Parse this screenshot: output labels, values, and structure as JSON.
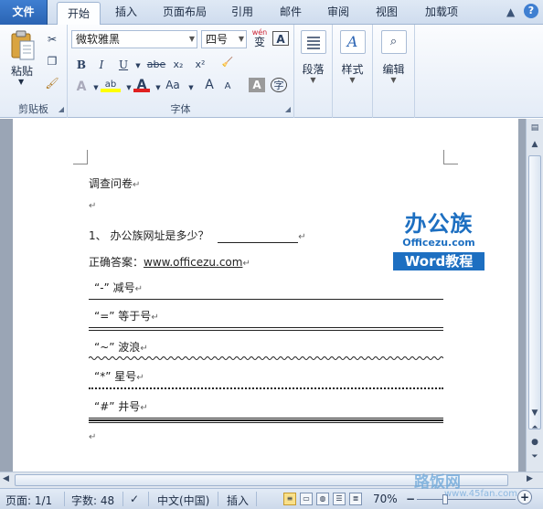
{
  "tabs": {
    "file": "文件",
    "items": [
      "开始",
      "插入",
      "页面布局",
      "引用",
      "邮件",
      "审阅",
      "视图",
      "加载项"
    ]
  },
  "ribbon": {
    "clipboard": {
      "paste_label": "粘贴",
      "group_label": "剪贴板"
    },
    "font": {
      "font_name": "微软雅黑",
      "font_size": "四号",
      "wen_label": "wén",
      "wen_char": "变",
      "bold": "B",
      "italic": "I",
      "underline": "U",
      "strike": "abe",
      "subscript": "x₂",
      "superscript": "x²",
      "aa_label": "Aa",
      "grow": "A",
      "shrink": "A",
      "char_shade": "A",
      "enclose": "字",
      "group_label": "字体"
    },
    "paragraph": {
      "label": "段落"
    },
    "styles": {
      "label": "样式"
    },
    "editing": {
      "label": "编辑"
    }
  },
  "document": {
    "title": "调查问卷",
    "question": "1、  办公族网址是多少？",
    "answer_label": "正确答案：",
    "answer_value": "www.officezu.com",
    "items": [
      {
        "text": "“-” 减号",
        "rule": "single"
      },
      {
        "text": "“=” 等于号",
        "rule": "double"
      },
      {
        "text": "“~” 波浪",
        "rule": "wavy"
      },
      {
        "text": "“*” 星号",
        "rule": "dotted"
      },
      {
        "text": "“#” 井号",
        "rule": "triple"
      }
    ],
    "watermark": {
      "line1": "办公族",
      "line2": "Officezu.com",
      "line3": "Word教程"
    }
  },
  "status": {
    "page": "页面: 1/1",
    "words": "字数: 48",
    "language": "中文(中国)",
    "mode": "插入",
    "zoom": "70%"
  },
  "overlay": {
    "site_name": "路饭网",
    "site_url": "www.45fan.com"
  },
  "colors": {
    "file_tab": "#2a63b3",
    "highlight": "#ffff00",
    "font_color": "#e02020",
    "logo_blue": "#1d6fc1"
  }
}
